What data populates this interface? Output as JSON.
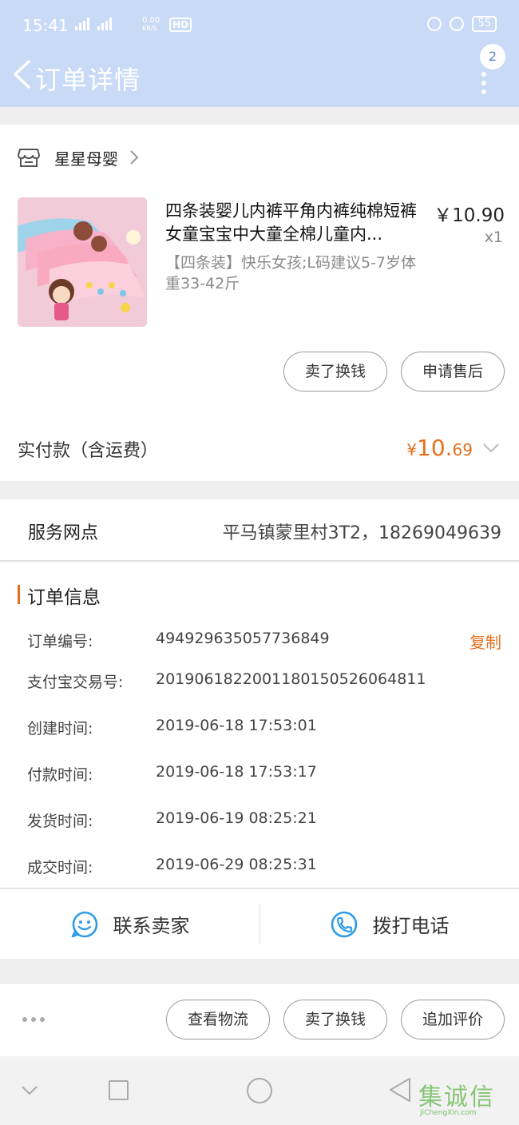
{
  "status_bar": {
    "time": "15:41",
    "speed": "0.00",
    "speed_unit": "KB/S",
    "hd": "HD",
    "battery": "55"
  },
  "header": {
    "title": "订单详情",
    "badge_count": "2",
    "background": "#c9daf6"
  },
  "shop": {
    "name": "星星母婴"
  },
  "product": {
    "title": "四条装婴儿内裤平角内裤纯棉短裤女童宝宝中大童全棉儿童内...",
    "price": "￥10.90",
    "quantity": "x1",
    "sku": "【四条装】快乐女孩;L码建议5-7岁体重33-42斤"
  },
  "item_actions": {
    "resell_label": "卖了换钱",
    "after_sale_label": "申请售后"
  },
  "payment": {
    "label": "实付款（含运费）",
    "currency": "¥",
    "integer": "10.",
    "decimal": "69",
    "accent": "#e46f1c"
  },
  "service": {
    "label": "服务网点",
    "value": "平马镇蒙里村3T2，18269049639"
  },
  "order_info": {
    "title": "订单信息",
    "copy_label": "复制",
    "rows": [
      {
        "key": "订单编号:",
        "value": "494929635057736849"
      },
      {
        "key": "支付宝交易号:",
        "value": "2019061822001180150526064811"
      },
      {
        "key": "创建时间:",
        "value": "2019-06-18 17:53:01"
      },
      {
        "key": "付款时间:",
        "value": "2019-06-18 17:53:17"
      },
      {
        "key": "发货时间:",
        "value": "2019-06-19 08:25:21"
      },
      {
        "key": "成交时间:",
        "value": "2019-06-29 08:25:31"
      }
    ]
  },
  "contact": {
    "seller_label": "联系卖家",
    "call_label": "拨打电话",
    "icon_color": "#2f9ce8"
  },
  "bottom_actions": {
    "logistics_label": "查看物流",
    "resell_label": "卖了换钱",
    "review_label": "追加评价"
  },
  "watermark": {
    "text": "集诚信",
    "url_text": "JiChengXin.com"
  }
}
